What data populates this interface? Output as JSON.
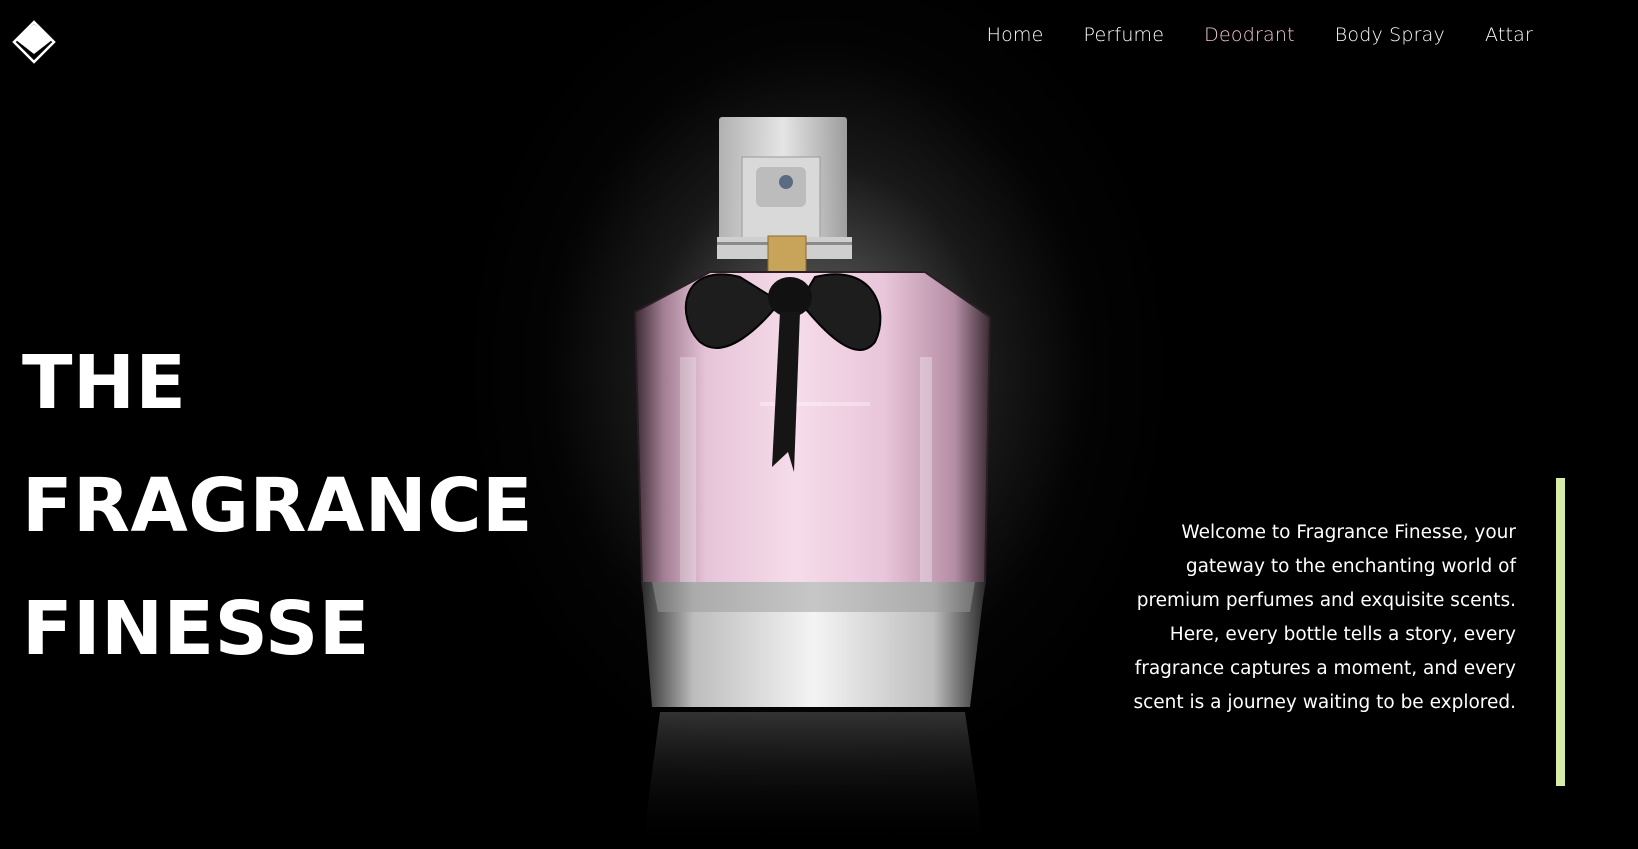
{
  "brand": {
    "logo_icon": "diamond-logo-icon"
  },
  "nav": {
    "items": [
      {
        "label": "Home",
        "active": false
      },
      {
        "label": "Perfume",
        "active": false
      },
      {
        "label": "Deodrant",
        "active": true
      },
      {
        "label": "Body Spray",
        "active": false
      },
      {
        "label": "Attar",
        "active": false
      }
    ],
    "active_color": "#f4c7d6"
  },
  "hero": {
    "title_lines": [
      "THE",
      "FRAGRANCE",
      "FINESSE"
    ],
    "description": "Welcome to Fragrance Finesse, your gateway to the enchanting world of premium perfumes and exquisite scents. Here, every bottle tells a story, every fragrance captures a moment, and every scent is a journey waiting to be explored.",
    "accent_color": "#d6eda8",
    "product_image": "perfume-bottle-pink"
  }
}
